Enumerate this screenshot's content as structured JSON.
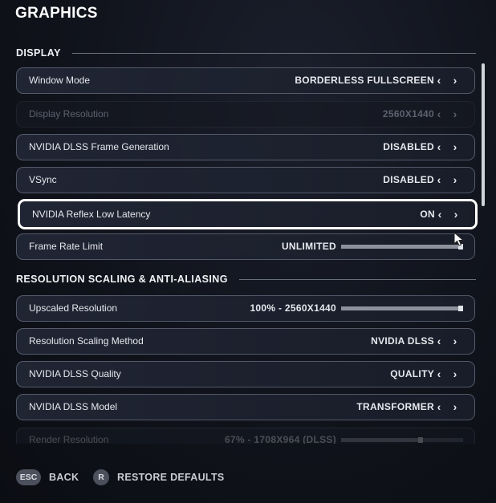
{
  "page": {
    "title": "GRAPHICS"
  },
  "sections": {
    "display": {
      "label": "DISPLAY"
    },
    "scaling": {
      "label": "RESOLUTION SCALING & ANTI-ALIASING"
    }
  },
  "settings": {
    "window_mode": {
      "label": "Window Mode",
      "value": "BORDERLESS FULLSCREEN"
    },
    "display_resolution": {
      "label": "Display Resolution",
      "value": "2560X1440",
      "enabled": false
    },
    "dlss_frame_generation": {
      "label": "NVIDIA DLSS Frame Generation",
      "value": "DISABLED"
    },
    "vsync": {
      "label": "VSync",
      "value": "DISABLED"
    },
    "reflex_low_latency": {
      "label": "NVIDIA Reflex Low Latency",
      "value": "ON",
      "selected": true
    },
    "frame_rate_limit": {
      "label": "Frame Rate Limit",
      "value": "UNLIMITED",
      "slider_fraction": 1.0
    },
    "upscaled_resolution": {
      "label": "Upscaled Resolution",
      "value": "100% - 2560X1440",
      "slider_fraction": 1.0
    },
    "resolution_scaling_method": {
      "label": "Resolution Scaling Method",
      "value": "NVIDIA DLSS"
    },
    "dlss_quality": {
      "label": "NVIDIA DLSS Quality",
      "value": "QUALITY"
    },
    "dlss_model": {
      "label": "NVIDIA DLSS Model",
      "value": "TRANSFORMER"
    },
    "render_resolution": {
      "label": "Render Resolution",
      "value": "67% - 1708X964 (DLSS)",
      "slider_fraction": 0.67
    }
  },
  "icons": {
    "arrow_left": "‹",
    "arrow_right": "›"
  },
  "footer": {
    "back": {
      "key": "ESC",
      "label": "BACK"
    },
    "restore": {
      "key": "R",
      "label": "RESTORE DEFAULTS"
    }
  }
}
